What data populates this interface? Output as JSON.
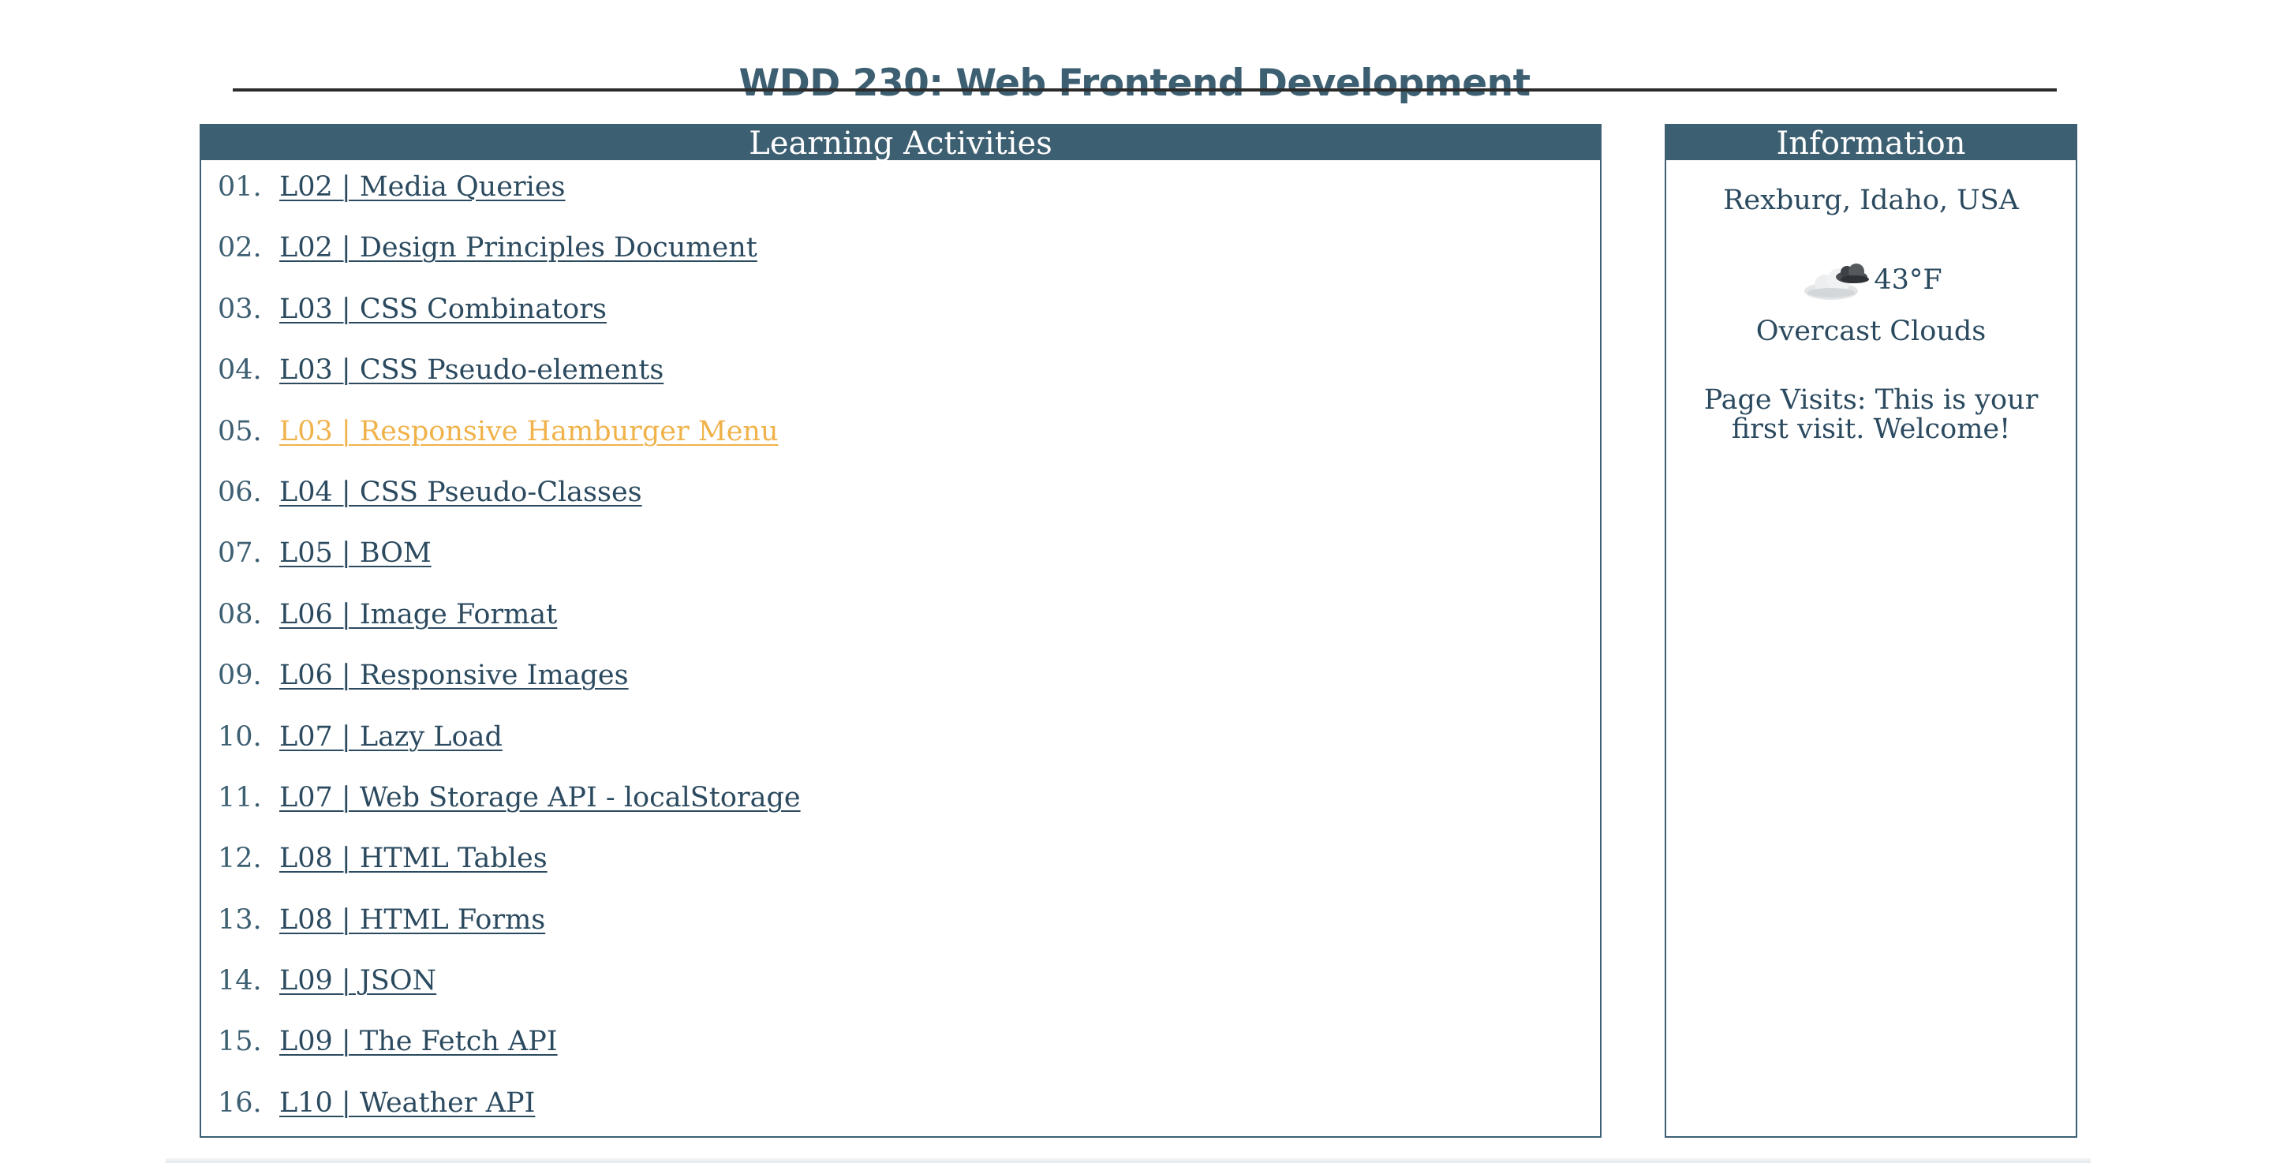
{
  "header": {
    "title": "WDD 230: Web Frontend Development"
  },
  "activities": {
    "heading": "Learning Activities",
    "items": [
      {
        "num": "01.",
        "label": "L02 | Media Queries"
      },
      {
        "num": "02.",
        "label": "L02 | Design Principles Document"
      },
      {
        "num": "03.",
        "label": "L03 | CSS Combinators"
      },
      {
        "num": "04.",
        "label": "L03 | CSS Pseudo-elements"
      },
      {
        "num": "05.",
        "label": "L03 | Responsive Hamburger Menu"
      },
      {
        "num": "06.",
        "label": "L04 | CSS Pseudo-Classes"
      },
      {
        "num": "07.",
        "label": "L05 | BOM"
      },
      {
        "num": "08.",
        "label": "L06 | Image Format"
      },
      {
        "num": "09.",
        "label": "L06 | Responsive Images"
      },
      {
        "num": "10.",
        "label": "L07 | Lazy Load"
      },
      {
        "num": "11.",
        "label": "L07 | Web Storage API - localStorage"
      },
      {
        "num": "12.",
        "label": "L08 | HTML Tables"
      },
      {
        "num": "13.",
        "label": "L08 | HTML Forms"
      },
      {
        "num": "14.",
        "label": "L09 | JSON"
      },
      {
        "num": "15.",
        "label": "L09 | The Fetch API"
      },
      {
        "num": "16.",
        "label": "L10 | Weather API"
      }
    ]
  },
  "information": {
    "heading": "Information",
    "location": "Rexburg, Idaho, USA",
    "weather": {
      "icon": "overcast-clouds-icon",
      "temperature": "43°F",
      "description": "Overcast Clouds"
    },
    "page_visits": "Page Visits: This is your first visit. Welcome!"
  },
  "colors": {
    "primary": "#3d5f72",
    "text": "#2b4a5f",
    "hover_link": "#f0b24a",
    "rule": "#2b2b2b"
  }
}
